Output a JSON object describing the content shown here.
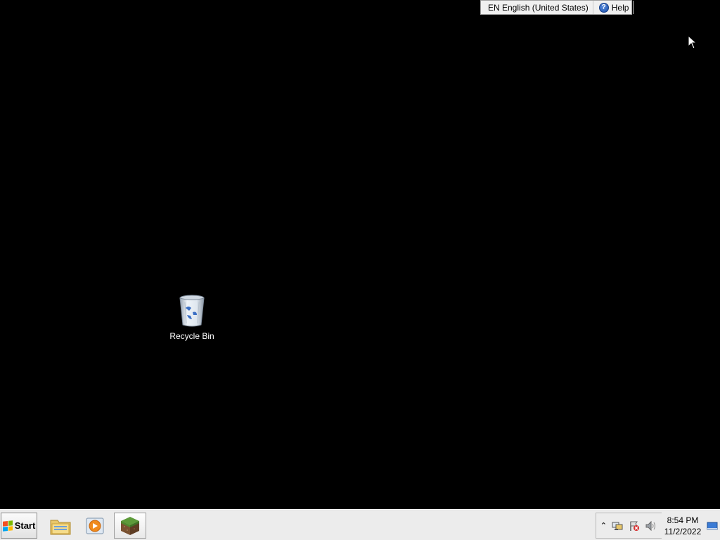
{
  "language_bar": {
    "language": "EN English (United States)",
    "help_label": "Help",
    "options_icon": "chevron-up-down-icon"
  },
  "desktop": {
    "background_color": "#000000",
    "icons": [
      {
        "label": "Recycle Bin",
        "icon": "recycle-bin-icon"
      }
    ]
  },
  "taskbar": {
    "start_label": "Start",
    "pinned": [
      {
        "name": "File Explorer",
        "icon": "folder-icon",
        "active": false
      },
      {
        "name": "Media Player",
        "icon": "media-player-icon",
        "active": false
      },
      {
        "name": "Minecraft",
        "icon": "minecraft-grass-block-icon",
        "active": true
      }
    ],
    "tray": {
      "icons": [
        "show-hidden-icons-chevron",
        "network-icon",
        "action-center-flag-icon",
        "volume-icon"
      ]
    },
    "clock": {
      "time": "8:54 PM",
      "date": "11/2/2022"
    }
  }
}
